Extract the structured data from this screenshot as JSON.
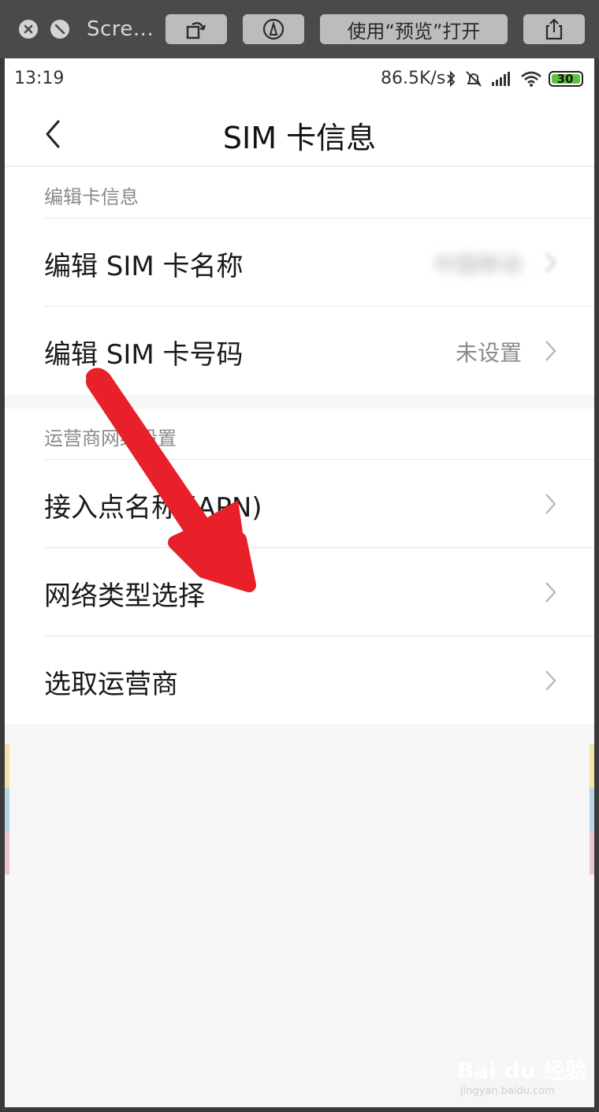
{
  "quicklook": {
    "title": "Scre...",
    "open_with_label": "使用“预览”打开"
  },
  "statusbar": {
    "time": "13:19",
    "net_speed": "86.5K/s",
    "battery": "30"
  },
  "header": {
    "title": "SIM 卡信息"
  },
  "sections": [
    {
      "header": "编辑卡信息",
      "rows": [
        {
          "label": "编辑 SIM 卡名称",
          "value": "中国移动"
        },
        {
          "label": "编辑 SIM 卡号码",
          "value": "未设置"
        }
      ]
    },
    {
      "header": "运营商网络设置",
      "rows": [
        {
          "label": "接入点名称 (APN)",
          "value": ""
        },
        {
          "label": "网络类型选择",
          "value": ""
        },
        {
          "label": "选取运营商",
          "value": ""
        }
      ]
    }
  ],
  "watermark": {
    "brand": "Bai du 经验",
    "url": "jingyan.baidu.com"
  },
  "colors": {
    "arrow": "#e8202a",
    "battery_fill": "#5bc236",
    "background": "#f6f6f6"
  }
}
